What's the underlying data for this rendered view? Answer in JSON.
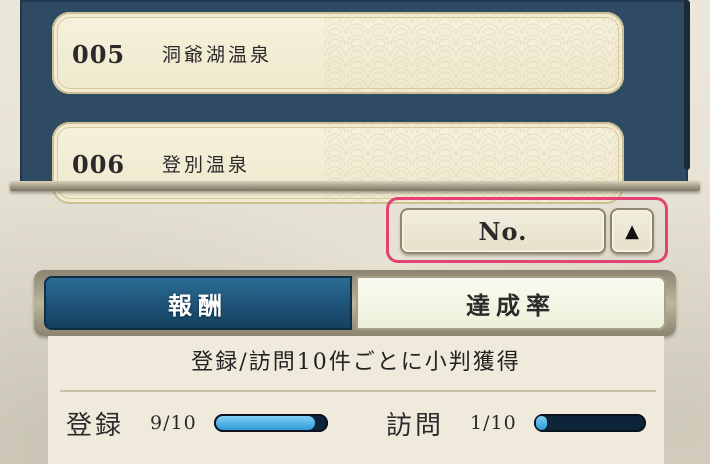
{
  "list": {
    "items": [
      {
        "number": "005",
        "name": "洞爺湖温泉"
      },
      {
        "number": "006",
        "name": "登別温泉"
      }
    ]
  },
  "sort": {
    "label": "No.",
    "order_icon": "▲",
    "order_icon_name": "ascending-triangle-icon"
  },
  "tabs": [
    {
      "label": "報酬",
      "active": true
    },
    {
      "label": "達成率",
      "active": false
    }
  ],
  "reward": {
    "condition": "登録/訪問10件ごとに小判獲得",
    "stats": [
      {
        "label": "登録",
        "value": "9/10",
        "progress": 0.9
      },
      {
        "label": "訪問",
        "value": "1/10",
        "progress": 0.1
      }
    ]
  },
  "colors": {
    "highlight_frame": "#e44272",
    "active_tab": "#1c4f73",
    "gauge_fill": "#2e9ad7",
    "board": "#2f4a63"
  }
}
